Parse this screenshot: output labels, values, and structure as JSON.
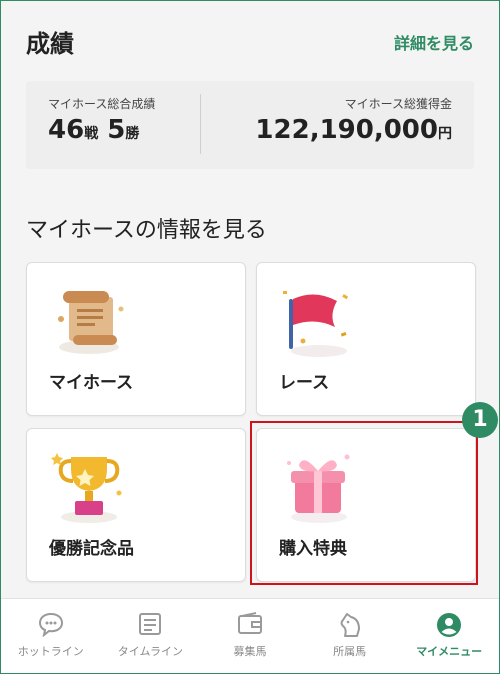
{
  "results": {
    "title": "成績",
    "detail_link": "詳細を見る",
    "total_record_label": "マイホース総合成績",
    "races": "46",
    "races_unit": "戦",
    "wins": "5",
    "wins_unit": "勝",
    "total_prize_label": "マイホース総獲得金",
    "prize": "122,190,000",
    "prize_unit": "円"
  },
  "info": {
    "title": "マイホースの情報を見る",
    "cards": [
      {
        "label": "マイホース",
        "icon": "scroll-icon"
      },
      {
        "label": "レース",
        "icon": "flag-icon"
      },
      {
        "label": "優勝記念品",
        "icon": "trophy-icon"
      },
      {
        "label": "購入特典",
        "icon": "gift-icon"
      }
    ]
  },
  "annotation": {
    "badge": "1"
  },
  "tabbar": {
    "items": [
      {
        "label": "ホットライン",
        "icon": "chat-bubble-icon"
      },
      {
        "label": "タイムライン",
        "icon": "document-icon"
      },
      {
        "label": "募集馬",
        "icon": "wallet-icon"
      },
      {
        "label": "所属馬",
        "icon": "horse-head-icon"
      },
      {
        "label": "マイメニュー",
        "icon": "person-icon"
      }
    ],
    "active_index": 4
  },
  "colors": {
    "accent": "#2e8b63",
    "highlight": "#d0121b"
  }
}
